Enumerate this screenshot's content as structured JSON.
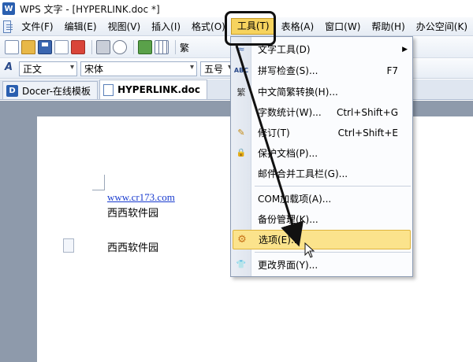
{
  "window": {
    "title": "WPS 文字 - [HYPERLINK.doc *]",
    "logo_letter": "W"
  },
  "menubar": {
    "items": [
      "文件(F)",
      "编辑(E)",
      "视图(V)",
      "插入(I)",
      "格式(O)",
      "工具(T)",
      "表格(A)",
      "窗口(W)",
      "帮助(H)",
      "办公空间(K)"
    ]
  },
  "toolbar": {
    "traditional_label": "繁"
  },
  "format_bar": {
    "style_value": "正文",
    "font_value": "宋体",
    "size_value": "五号"
  },
  "tabs": [
    {
      "label": "Docer-在线模板",
      "logo_letter": "D"
    },
    {
      "label": "HYPERLINK.doc"
    }
  ],
  "document": {
    "link": "www.cr173.com",
    "line1": "西西软件园",
    "line2": "西西软件园"
  },
  "tools_menu": {
    "items": [
      {
        "label": "文字工具(D)",
        "shortcut": "",
        "submenu": true,
        "icon": "text-tool-icon",
        "glyph": "≈"
      },
      {
        "label": "拼写检查(S)...",
        "shortcut": "F7",
        "icon": "spellcheck-icon",
        "glyph": "ABC"
      },
      {
        "label": "中文简繁转换(H)...",
        "shortcut": "",
        "icon": "convert-icon",
        "glyph": "繁"
      },
      {
        "label": "字数统计(W)...",
        "shortcut": "Ctrl+Shift+G",
        "icon": "",
        "glyph": ""
      },
      {
        "label": "修订(T)",
        "shortcut": "Ctrl+Shift+E",
        "icon": "revision-icon",
        "glyph": "✎"
      },
      {
        "label": "保护文档(P)...",
        "shortcut": "",
        "icon": "protect-icon",
        "glyph": "🔒"
      },
      {
        "label": "邮件合并工具栏(G)...",
        "shortcut": "",
        "icon": "",
        "glyph": ""
      },
      {
        "label": "COM加载项(A)...",
        "shortcut": "",
        "icon": "",
        "glyph": ""
      },
      {
        "label": "备份管理(K)...",
        "shortcut": "",
        "icon": "",
        "glyph": ""
      },
      {
        "label": "选项(E)...",
        "shortcut": "",
        "icon": "options-gear-icon",
        "glyph": "⚙"
      },
      {
        "label": "更改界面(Y)...",
        "shortcut": "",
        "icon": "skin-icon",
        "glyph": "👕"
      }
    ]
  },
  "colors": {
    "menu_highlight": "#f6d35e",
    "link": "#1a3ccf",
    "workspace": "#8e9aab"
  }
}
